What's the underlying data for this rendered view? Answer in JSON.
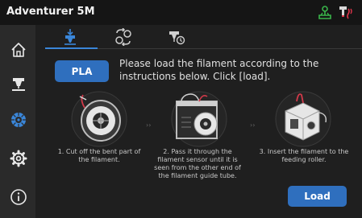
{
  "app": {
    "title": "Adventurer 5M"
  },
  "status_icons": [
    {
      "icon": "network-connected-icon",
      "color": "#39b54a"
    },
    {
      "icon": "temperature-alert-icon",
      "color": "#e0344a"
    }
  ],
  "sidebar": {
    "items": [
      {
        "icon": "home-icon",
        "active": false
      },
      {
        "icon": "nozzle-icon",
        "active": false
      },
      {
        "icon": "filament-spool-icon",
        "active": true
      },
      {
        "icon": "gear-icon",
        "active": false
      },
      {
        "icon": "info-icon",
        "active": false
      }
    ]
  },
  "tabs": [
    {
      "icon": "load-filament-icon",
      "active": true
    },
    {
      "icon": "change-filament-icon",
      "active": false
    },
    {
      "icon": "unload-filament-icon",
      "active": false
    }
  ],
  "material": {
    "label": "PLA"
  },
  "instructions": {
    "text": "Please load the filament according to the instructions below. Click [load]."
  },
  "steps": [
    {
      "caption": "1. Cut off the bent part of the filament."
    },
    {
      "caption": "2. Pass it through the filament sensor until it is seen from the other end of the filament guide tube."
    },
    {
      "caption": "3. Insert the filament to the feeding roller."
    }
  ],
  "step_separator": "››",
  "actions": {
    "load_label": "Load"
  },
  "colors": {
    "accent": "#2f6fbe",
    "active_icon": "#3a86d9",
    "background": "#1f1f1f"
  }
}
